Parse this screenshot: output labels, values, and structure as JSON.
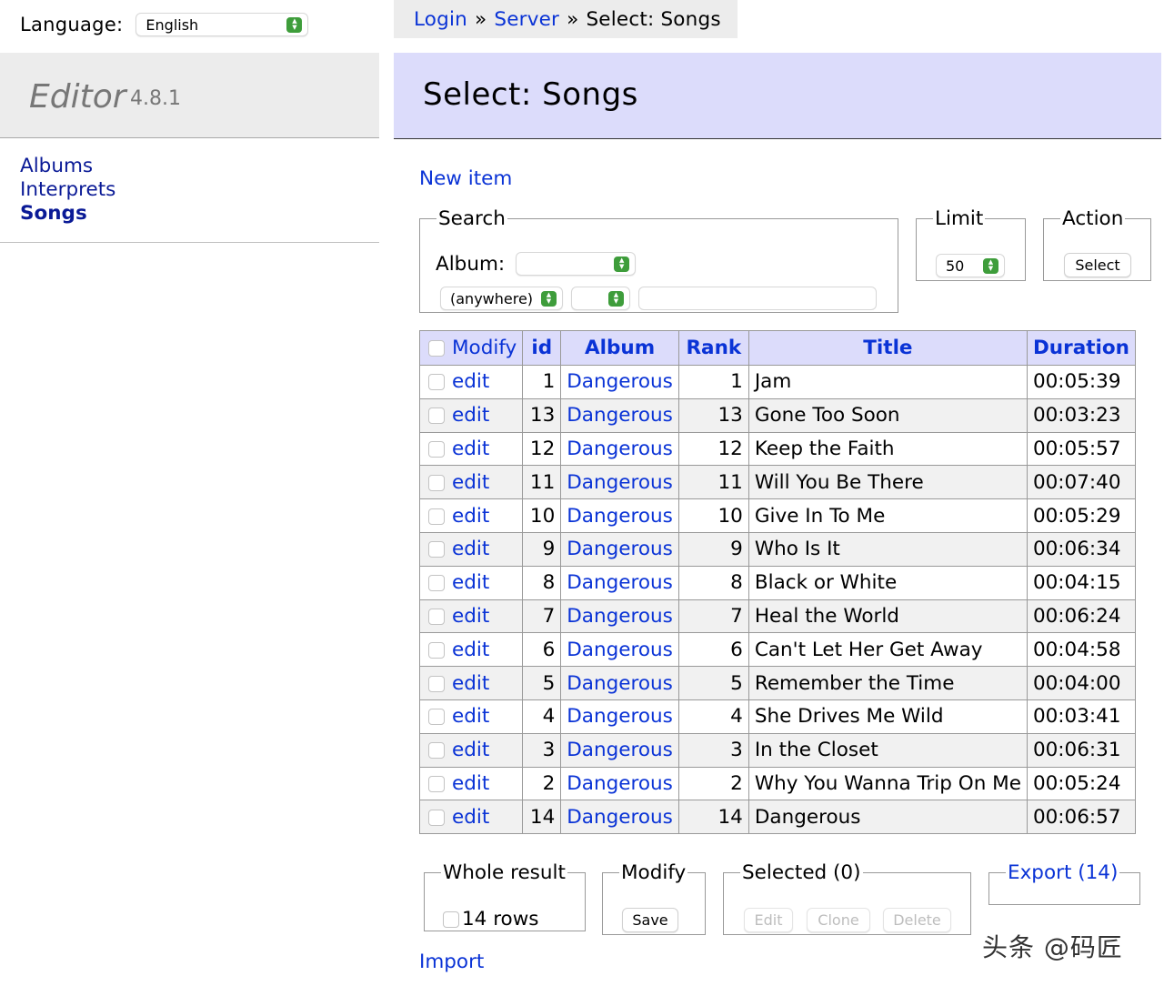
{
  "language": {
    "label": "Language:",
    "value": "English"
  },
  "app": {
    "name": "Editor",
    "version": "4.8.1"
  },
  "menu": {
    "items": [
      {
        "label": "Albums"
      },
      {
        "label": "Interprets"
      },
      {
        "label": "Songs"
      }
    ]
  },
  "breadcrumb": {
    "login": "Login",
    "sep1": "»",
    "server": "Server",
    "sep2": "»",
    "current": "Select: Songs"
  },
  "page": {
    "title": "Select: Songs",
    "new_item": "New item"
  },
  "search": {
    "legend": "Search",
    "album_label": "Album:",
    "album_value": "",
    "where_value": "(anywhere)",
    "op_value": "",
    "text_value": ""
  },
  "limit": {
    "legend": "Limit",
    "value": "50"
  },
  "action": {
    "legend": "Action",
    "button": "Select"
  },
  "table": {
    "headers": {
      "modify": "Modify",
      "id": "id",
      "album": "Album",
      "rank": "Rank",
      "title": "Title",
      "duration": "Duration"
    },
    "edit_label": "edit",
    "rows": [
      {
        "id": "1",
        "album": "Dangerous",
        "rank": "1",
        "title": "Jam",
        "duration": "00:05:39"
      },
      {
        "id": "13",
        "album": "Dangerous",
        "rank": "13",
        "title": "Gone Too Soon",
        "duration": "00:03:23"
      },
      {
        "id": "12",
        "album": "Dangerous",
        "rank": "12",
        "title": "Keep the Faith",
        "duration": "00:05:57"
      },
      {
        "id": "11",
        "album": "Dangerous",
        "rank": "11",
        "title": "Will You Be There",
        "duration": "00:07:40"
      },
      {
        "id": "10",
        "album": "Dangerous",
        "rank": "10",
        "title": "Give In To Me",
        "duration": "00:05:29"
      },
      {
        "id": "9",
        "album": "Dangerous",
        "rank": "9",
        "title": "Who Is It",
        "duration": "00:06:34"
      },
      {
        "id": "8",
        "album": "Dangerous",
        "rank": "8",
        "title": "Black or White",
        "duration": "00:04:15"
      },
      {
        "id": "7",
        "album": "Dangerous",
        "rank": "7",
        "title": "Heal the World",
        "duration": "00:06:24"
      },
      {
        "id": "6",
        "album": "Dangerous",
        "rank": "6",
        "title": "Can't Let Her Get Away",
        "duration": "00:04:58"
      },
      {
        "id": "5",
        "album": "Dangerous",
        "rank": "5",
        "title": "Remember the Time",
        "duration": "00:04:00"
      },
      {
        "id": "4",
        "album": "Dangerous",
        "rank": "4",
        "title": "She Drives Me Wild",
        "duration": "00:03:41"
      },
      {
        "id": "3",
        "album": "Dangerous",
        "rank": "3",
        "title": "In the Closet",
        "duration": "00:06:31"
      },
      {
        "id": "2",
        "album": "Dangerous",
        "rank": "2",
        "title": "Why You Wanna Trip On Me",
        "duration": "00:05:24"
      },
      {
        "id": "14",
        "album": "Dangerous",
        "rank": "14",
        "title": "Dangerous",
        "duration": "00:06:57"
      }
    ]
  },
  "bottom": {
    "whole_result": {
      "legend": "Whole result",
      "rows_label": "14 rows"
    },
    "modify": {
      "legend": "Modify",
      "save": "Save"
    },
    "selected": {
      "legend": "Selected (0)",
      "edit": "Edit",
      "clone": "Clone",
      "delete": "Delete"
    },
    "export": {
      "legend": "Export (14)"
    },
    "import": "Import"
  },
  "watermark": "头条 @码匠"
}
